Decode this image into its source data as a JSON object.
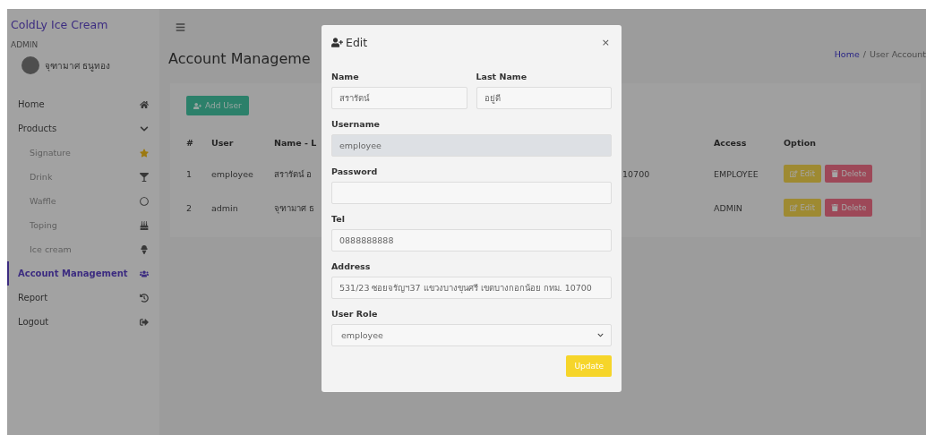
{
  "sidebar": {
    "brand": "ColdLy Ice Cream",
    "role": "ADMIN",
    "user_name": "จุฑามาศ ธนูทอง",
    "items": [
      {
        "label": "Home",
        "selected": false
      },
      {
        "label": "Products",
        "selected": false,
        "expanded": true,
        "children": [
          {
            "label": "Signature",
            "selected": false
          },
          {
            "label": "Drink",
            "selected": false
          },
          {
            "label": "Waffle",
            "selected": false
          },
          {
            "label": "Toping",
            "selected": false
          },
          {
            "label": "Ice cream",
            "selected": false
          }
        ]
      },
      {
        "label": "Account Management",
        "selected": true
      },
      {
        "label": "Report",
        "selected": false
      },
      {
        "label": "Logout",
        "selected": false
      }
    ]
  },
  "page": {
    "title": "Account Manageme",
    "breadcrumb": [
      {
        "label": "Home",
        "link": true
      },
      {
        "label": "User Account",
        "link": false
      }
    ],
    "breadcrumb_separator": "/"
  },
  "add_button": "Add User",
  "table": {
    "columns": [
      "#",
      "User",
      "Name - L",
      "Access",
      "Option"
    ],
    "rows": [
      {
        "index": "1",
        "user": "employee",
        "name": "สรารัตน์ อ",
        "column_4": "10700",
        "access": "EMPLOYEE",
        "actions": [
          "Edit",
          "Delete"
        ]
      },
      {
        "index": "2",
        "user": "admin",
        "name": "จุฑามาศ ธ",
        "access": "ADMIN",
        "actions": [
          "Edit",
          "Delete"
        ]
      }
    ]
  },
  "modal": {
    "title": "Edit",
    "close": "×",
    "rows": [
      [
        {
          "label": "Name",
          "kind": "text",
          "value": "สรารัตน์",
          "disabled": false
        },
        {
          "label": "Last Name",
          "kind": "text",
          "value": "อยู่ดี",
          "disabled": false
        }
      ],
      [
        {
          "label": "Username",
          "kind": "text",
          "value": "employee",
          "disabled": true
        }
      ],
      [
        {
          "label": "Password",
          "kind": "password",
          "disabled": false
        }
      ],
      [
        {
          "label": "Tel",
          "kind": "text",
          "value": "0888888888",
          "disabled": false
        }
      ],
      [
        {
          "label": "Address",
          "kind": "text",
          "value": "531/23 ซอยจรัญฯ37 แขวงบางขุนศรี เขตบางกอกน้อย กทม. 10700",
          "disabled": false
        }
      ],
      [
        {
          "label": "User Role",
          "kind": "select",
          "value": "employee",
          "disabled": false
        }
      ]
    ],
    "submit": "Update"
  }
}
